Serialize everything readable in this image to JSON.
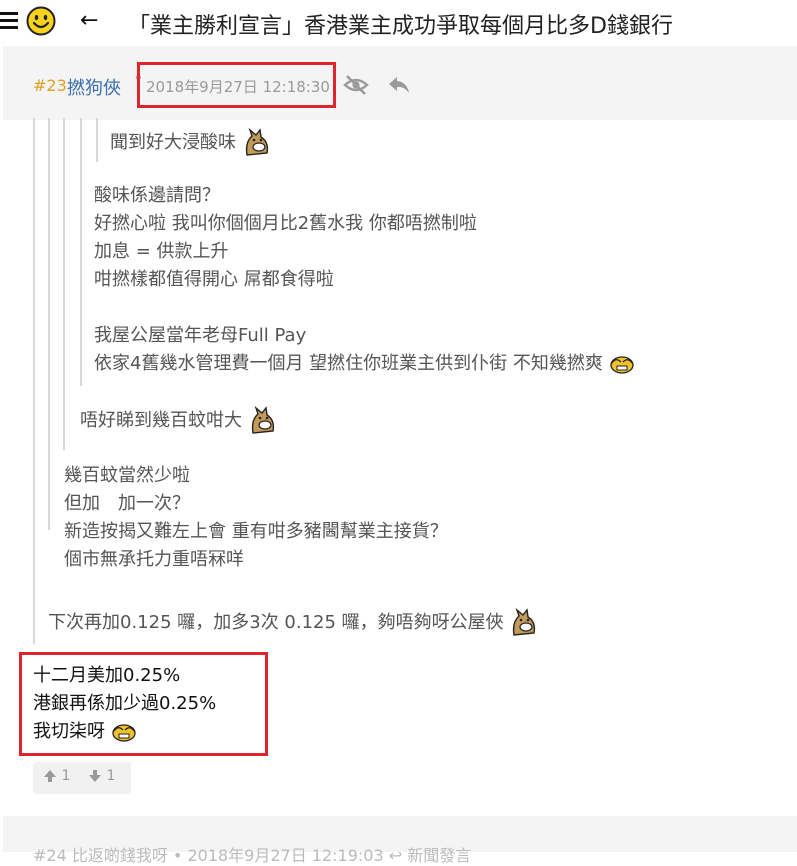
{
  "header": {
    "title": "「業主勝利宣言」香港業主成功爭取每個月比多D錢銀行",
    "back_glyph": "←"
  },
  "post": {
    "number": "#23",
    "username": "撚狗俠",
    "separator": "•",
    "timestamp": "2018年9月27日 12:18:30",
    "votes": {
      "up": "1",
      "down": "1"
    }
  },
  "quotes": {
    "level4": [
      "聞到好大浸酸味"
    ],
    "level3": [
      "酸味係邊請問？",
      "好撚心啦 我叫你個個月比2舊水我 你都唔撚制啦",
      "加息 = 供款上升",
      "咁撚樣都值得開心 屌都食得啦",
      "",
      "我屋公屋當年老母Full Pay",
      "依家4舊幾水管理費一個月 望撚住你班業主供到仆街 不知幾撚爽"
    ],
    "level2": [
      "唔好睇到幾百蚊咁大"
    ],
    "level1": [
      "幾百蚊當然少啦",
      "但加　加一次？",
      "新造按揭又難左上會 重有咁多豬閪幫業主接貨？",
      "個市無承托力重唔冧咩"
    ],
    "level0": [
      "下次再加0.125 囉，加多3次 0.125 囉，夠唔夠呀公屋俠"
    ]
  },
  "reply": [
    "十二月美加0.25%",
    "港銀再係加少過0.25%",
    "我切柒呀"
  ],
  "next_post_preview": "#24 比返啲錢我呀  •  2018年9月27日 12:19:03  ↩  新聞發言"
}
